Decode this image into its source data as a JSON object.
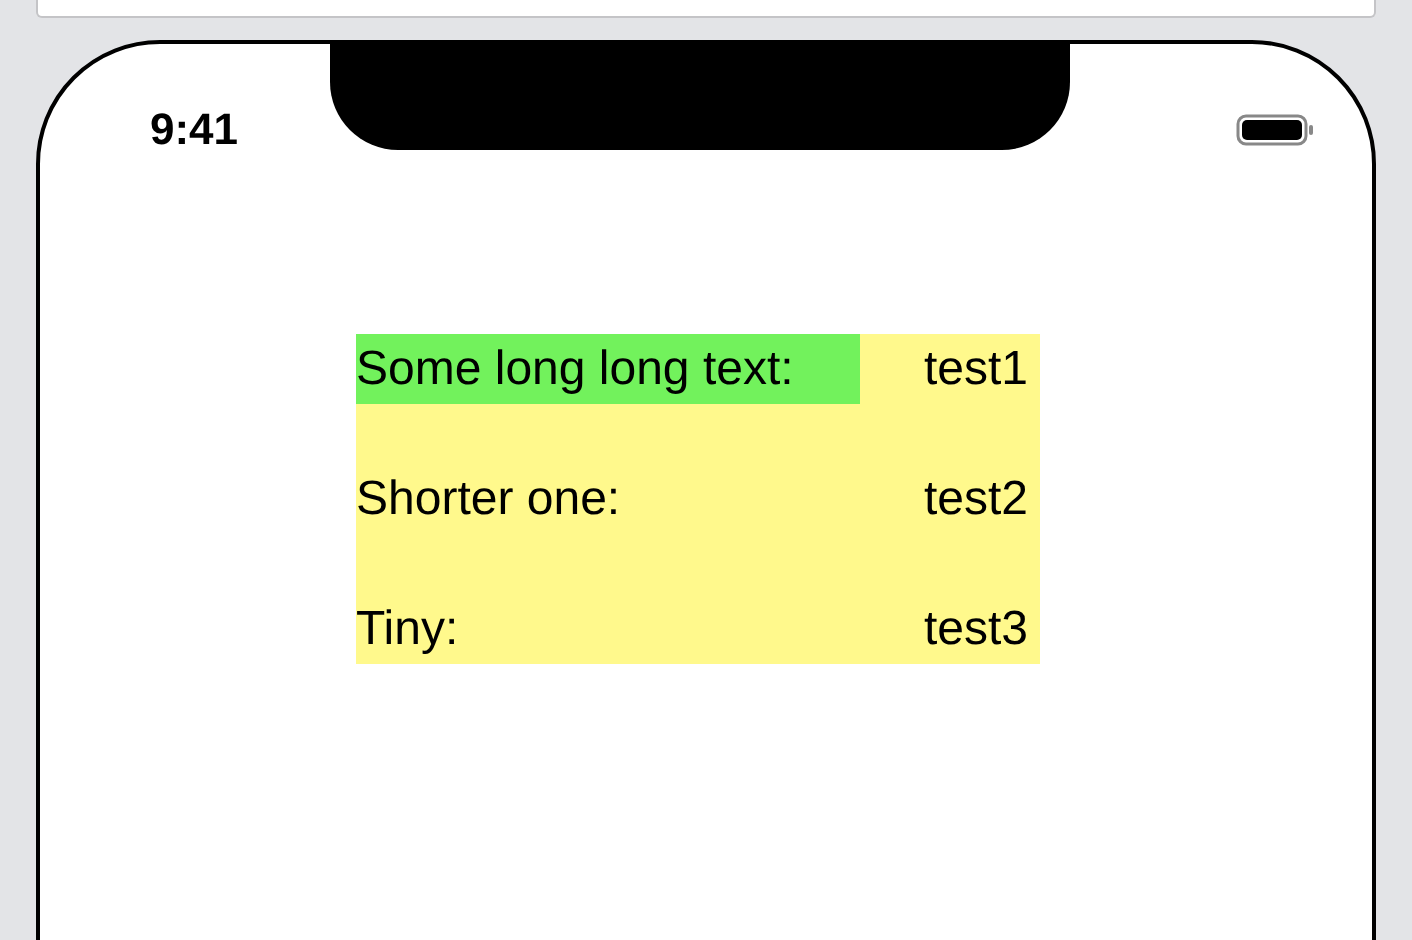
{
  "status_bar": {
    "time": "9:41"
  },
  "rows": [
    {
      "label": "Some long long text:",
      "value": "test1",
      "highlighted": true
    },
    {
      "label": "Shorter one:",
      "value": "test2",
      "highlighted": false
    },
    {
      "label": "Tiny:",
      "value": "test3",
      "highlighted": false
    }
  ]
}
